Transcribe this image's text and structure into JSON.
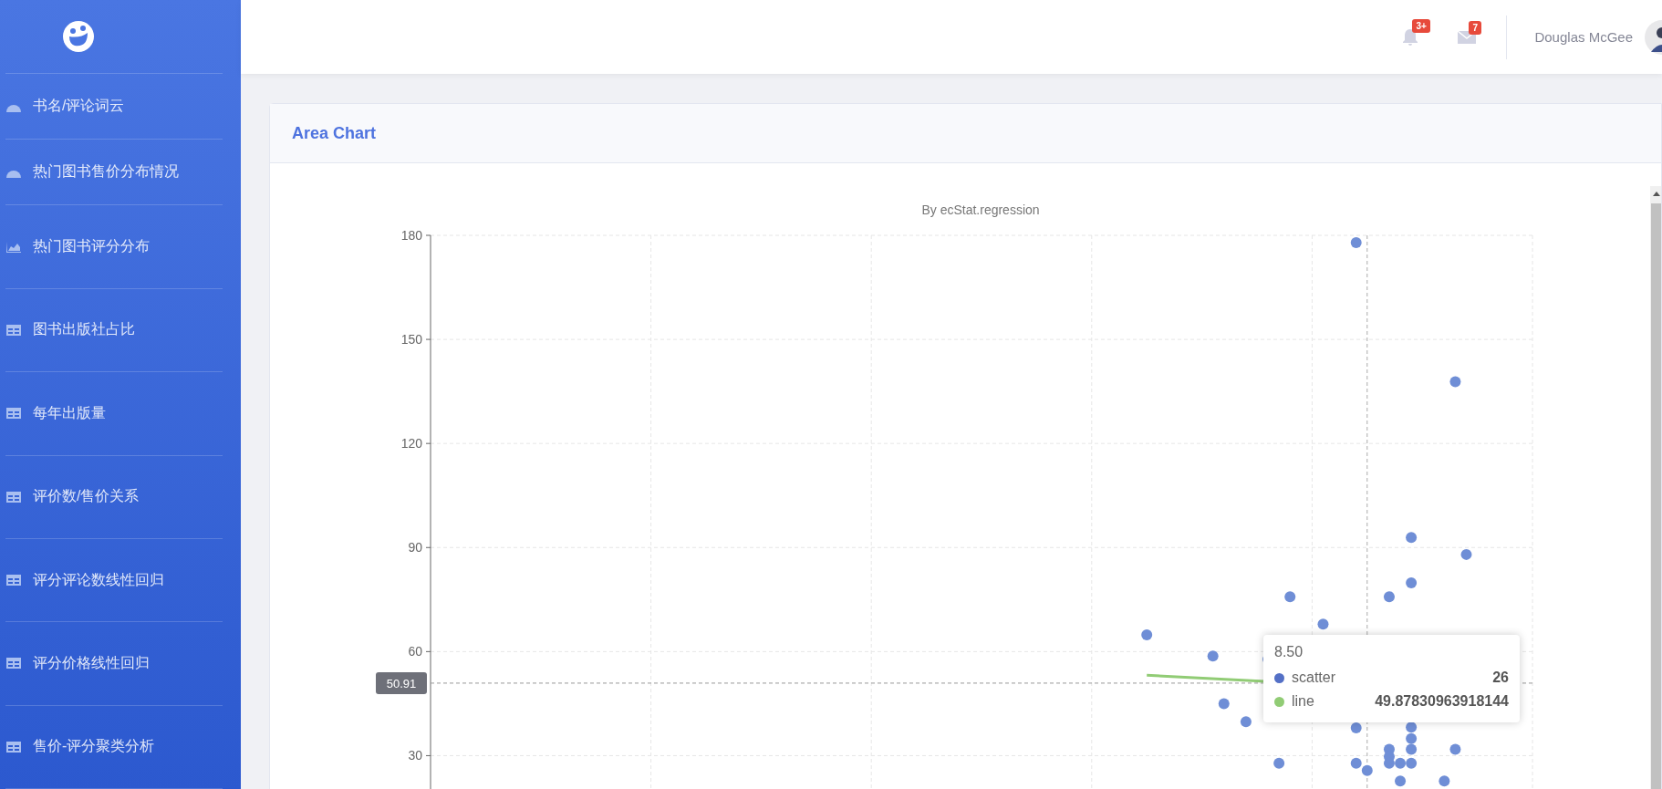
{
  "sidebar": {
    "items": [
      {
        "label": "书名/评论词云",
        "kind": "dashboard"
      },
      {
        "label": "热门图书售价分布情况",
        "kind": "dashboard"
      },
      {
        "label": "热门图书评分分布",
        "kind": "chart"
      },
      {
        "label": "图书出版社占比",
        "kind": "table"
      },
      {
        "label": "每年出版量",
        "kind": "table"
      },
      {
        "label": "评价数/售价关系",
        "kind": "table"
      },
      {
        "label": "评分评论数线性回归",
        "kind": "table"
      },
      {
        "label": "评分价格线性回归",
        "kind": "table"
      },
      {
        "label": "售价-评分聚类分析",
        "kind": "table"
      }
    ]
  },
  "topbar": {
    "alerts_badge": "3+",
    "messages_badge": "7",
    "user_name": "Douglas McGee"
  },
  "card": {
    "title": "Area Chart",
    "chart": {
      "subtitle": "By ecStat.regression",
      "axis_pointer_label": "50.91",
      "y_axis_labels": [
        "180",
        "150",
        "120",
        "90",
        "60",
        "30"
      ],
      "tooltip": {
        "title": "8.50",
        "rows": [
          {
            "name": "scatter",
            "value": "26",
            "color": "#5470c6"
          },
          {
            "name": "line",
            "value": "49.87830963918144",
            "color": "#91cc75"
          }
        ]
      }
    }
  }
}
